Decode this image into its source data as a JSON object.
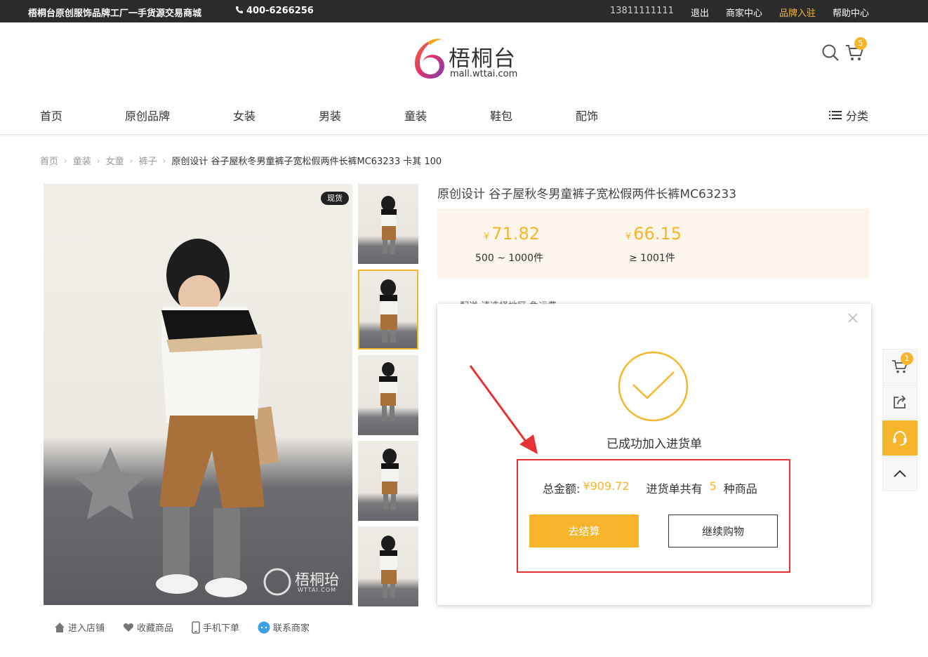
{
  "topbar": {
    "slogan": "梧桐台原创服饰品牌工厂一手货源交易商城",
    "phone": "400-6266256",
    "user": "13811111111",
    "logout": "退出",
    "merchant_center": "商家中心",
    "brand_join": "品牌入驻",
    "help_center": "帮助中心"
  },
  "logo": {
    "name": "梧桐台",
    "url": "mall.wttai.com"
  },
  "cart": {
    "count": "5"
  },
  "nav": {
    "items": [
      "首页",
      "原创品牌",
      "女装",
      "男装",
      "童装",
      "鞋包",
      "配饰"
    ],
    "category": "分类"
  },
  "breadcrumb": {
    "items": [
      "首页",
      "童装",
      "女童",
      "裤子"
    ],
    "current": "原创设计 谷子屋秋冬男童裤子宽松假两件长裤MC63233 卡其 100"
  },
  "product": {
    "stock_badge": "现货",
    "title": "原创设计 谷子屋秋冬男童裤子宽松假两件长裤MC63233",
    "currency": "¥",
    "prices": [
      {
        "value": "71.82",
        "tier": "500 ~ 1000件"
      },
      {
        "value": "66.15",
        "tier": "≥ 1001件"
      }
    ],
    "shipping_partial": "配送    请选择地区  免运费",
    "watermark": "梧桐珆",
    "watermark_url": "WTTAI.COM"
  },
  "actions": {
    "shop": "进入店铺",
    "favorite": "收藏商品",
    "mobile": "手机下单",
    "contact": "联系商家"
  },
  "sidebar": {
    "cart_count": "1"
  },
  "modal": {
    "success": "已成功加入进货单",
    "total_label": "总金额:",
    "total_value": "¥909.72",
    "count_prefix": "进货单共有",
    "count_value": "5",
    "count_suffix": "种商品",
    "checkout": "去结算",
    "continue": "继续购物"
  },
  "colors": {
    "accent": "#f7b52b",
    "topbar": "#2b2b2b",
    "highlight_box": "#e63232",
    "price_bg": "#fbf5ec"
  }
}
